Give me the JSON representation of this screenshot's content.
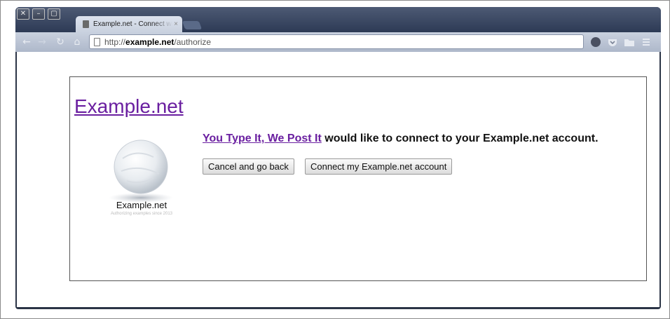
{
  "window": {
    "controls": [
      {
        "name": "close-icon",
        "glyph": "✕"
      },
      {
        "name": "minimize-icon",
        "glyph": "–"
      },
      {
        "name": "maximize-icon",
        "glyph": "▢"
      }
    ]
  },
  "browser": {
    "tab_title": "Example.net - Connect wi",
    "tab_close": "×",
    "url_scheme": "http://",
    "url_host": "example.net",
    "url_path": "/authorize",
    "nav_icons": [
      "back-icon",
      "forward-icon",
      "reload-icon",
      "home-icon"
    ],
    "extension_icons": [
      "extension-dark-icon",
      "pocket-icon",
      "folder-icon",
      "menu-icon"
    ]
  },
  "auth_page": {
    "site_title": "Example.net",
    "logo_name": "Example.net",
    "logo_tagline": "Authorizing examples since 2013",
    "app_name": "You Type It, We Post It",
    "message_rest": " would like to connect to your Example.net account.",
    "cancel_label": "Cancel and go back",
    "connect_label": "Connect my Example.net account"
  },
  "colors": {
    "link_purple": "#6a1fa0",
    "titlebar": "#2d3a55"
  }
}
